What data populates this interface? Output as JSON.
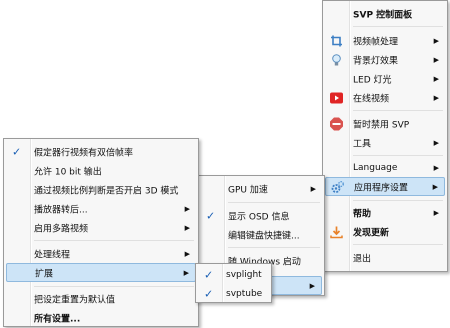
{
  "main_menu": {
    "title": "SVP 控制面板",
    "items": [
      {
        "label": "视频帧处理"
      },
      {
        "label": "背景灯效果"
      },
      {
        "label": "LED 灯光"
      },
      {
        "label": "在线视频"
      },
      {
        "label": "暂时禁用 SVP"
      },
      {
        "label": "工具"
      },
      {
        "label": "Language"
      },
      {
        "label": "应用程序设置"
      },
      {
        "label": "帮助"
      },
      {
        "label": "发现更新"
      },
      {
        "label": "退出"
      }
    ]
  },
  "settings_menu": {
    "items": [
      {
        "label": "假定器行视频有双倍帧率"
      },
      {
        "label": "允许 10 bit 输出"
      },
      {
        "label": "通过视频比例判断是否开启 3D 模式"
      },
      {
        "label": "播放器转后..."
      },
      {
        "label": "启用多路视频"
      },
      {
        "label": "处理线程"
      },
      {
        "label": "扩展"
      },
      {
        "label": "把设定重置为默认值"
      },
      {
        "label": "所有设置..."
      }
    ]
  },
  "sub_menu": {
    "items": [
      {
        "label": "GPU 加速"
      },
      {
        "label": "显示 OSD 信息"
      },
      {
        "label": "编辑键盘快捷键..."
      },
      {
        "label": "随 Windows 启动"
      }
    ]
  },
  "ext_menu": {
    "items": [
      {
        "label": "svplight"
      },
      {
        "label": "svptube"
      }
    ]
  },
  "colors": {
    "highlight": "#cde4f7",
    "check": "#1a5fb4",
    "youtube_red": "#e02424",
    "stop_red": "#d9534f",
    "update_orange": "#e8822a",
    "gear_blue": "#3d7fc4"
  }
}
